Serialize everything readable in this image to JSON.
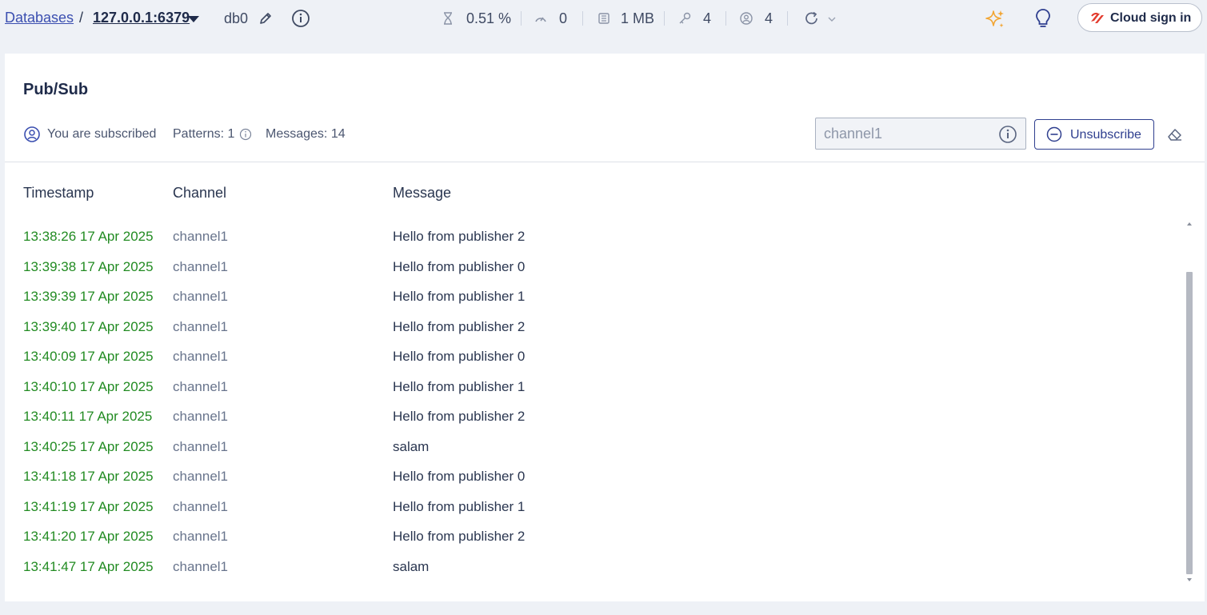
{
  "header": {
    "breadcrumb_root": "Databases",
    "separator": "/",
    "host": "127.0.0.1:6379",
    "db": "db0",
    "stats": {
      "cpu": "0.51 %",
      "ops": "0",
      "memory": "1 MB",
      "keys": "4",
      "clients": "4"
    },
    "cloud_label": "Cloud sign in"
  },
  "pubsub": {
    "title": "Pub/Sub",
    "subscribed_text": "You are subscribed",
    "patterns_text": "Patterns: 1",
    "messages_text": "Messages: 14",
    "channel_value": "",
    "channel_placeholder": "channel1",
    "unsubscribe_label": "Unsubscribe",
    "columns": [
      "Timestamp",
      "Channel",
      "Message"
    ],
    "rows": [
      {
        "timestamp": "13:38:26 17 Apr 2025",
        "channel": "channel1",
        "message": "Hello from publisher 2"
      },
      {
        "timestamp": "13:39:38 17 Apr 2025",
        "channel": "channel1",
        "message": "Hello from publisher 0"
      },
      {
        "timestamp": "13:39:39 17 Apr 2025",
        "channel": "channel1",
        "message": "Hello from publisher 1"
      },
      {
        "timestamp": "13:39:40 17 Apr 2025",
        "channel": "channel1",
        "message": "Hello from publisher 2"
      },
      {
        "timestamp": "13:40:09 17 Apr 2025",
        "channel": "channel1",
        "message": "Hello from publisher 0"
      },
      {
        "timestamp": "13:40:10 17 Apr 2025",
        "channel": "channel1",
        "message": "Hello from publisher 1"
      },
      {
        "timestamp": "13:40:11 17 Apr 2025",
        "channel": "channel1",
        "message": "Hello from publisher 2"
      },
      {
        "timestamp": "13:40:25 17 Apr 2025",
        "channel": "channel1",
        "message": "salam"
      },
      {
        "timestamp": "13:41:18 17 Apr 2025",
        "channel": "channel1",
        "message": "Hello from publisher 0"
      },
      {
        "timestamp": "13:41:19 17 Apr 2025",
        "channel": "channel1",
        "message": "Hello from publisher 1"
      },
      {
        "timestamp": "13:41:20 17 Apr 2025",
        "channel": "channel1",
        "message": "Hello from publisher 2"
      },
      {
        "timestamp": "13:41:47 17 Apr 2025",
        "channel": "channel1",
        "message": "salam"
      }
    ]
  },
  "colors": {
    "timestamp": "#228b22",
    "accent": "#2f3f8f",
    "ai_sparkle": "#f2a533",
    "brand_red": "#e33b2e",
    "background": "#eef1f6"
  }
}
